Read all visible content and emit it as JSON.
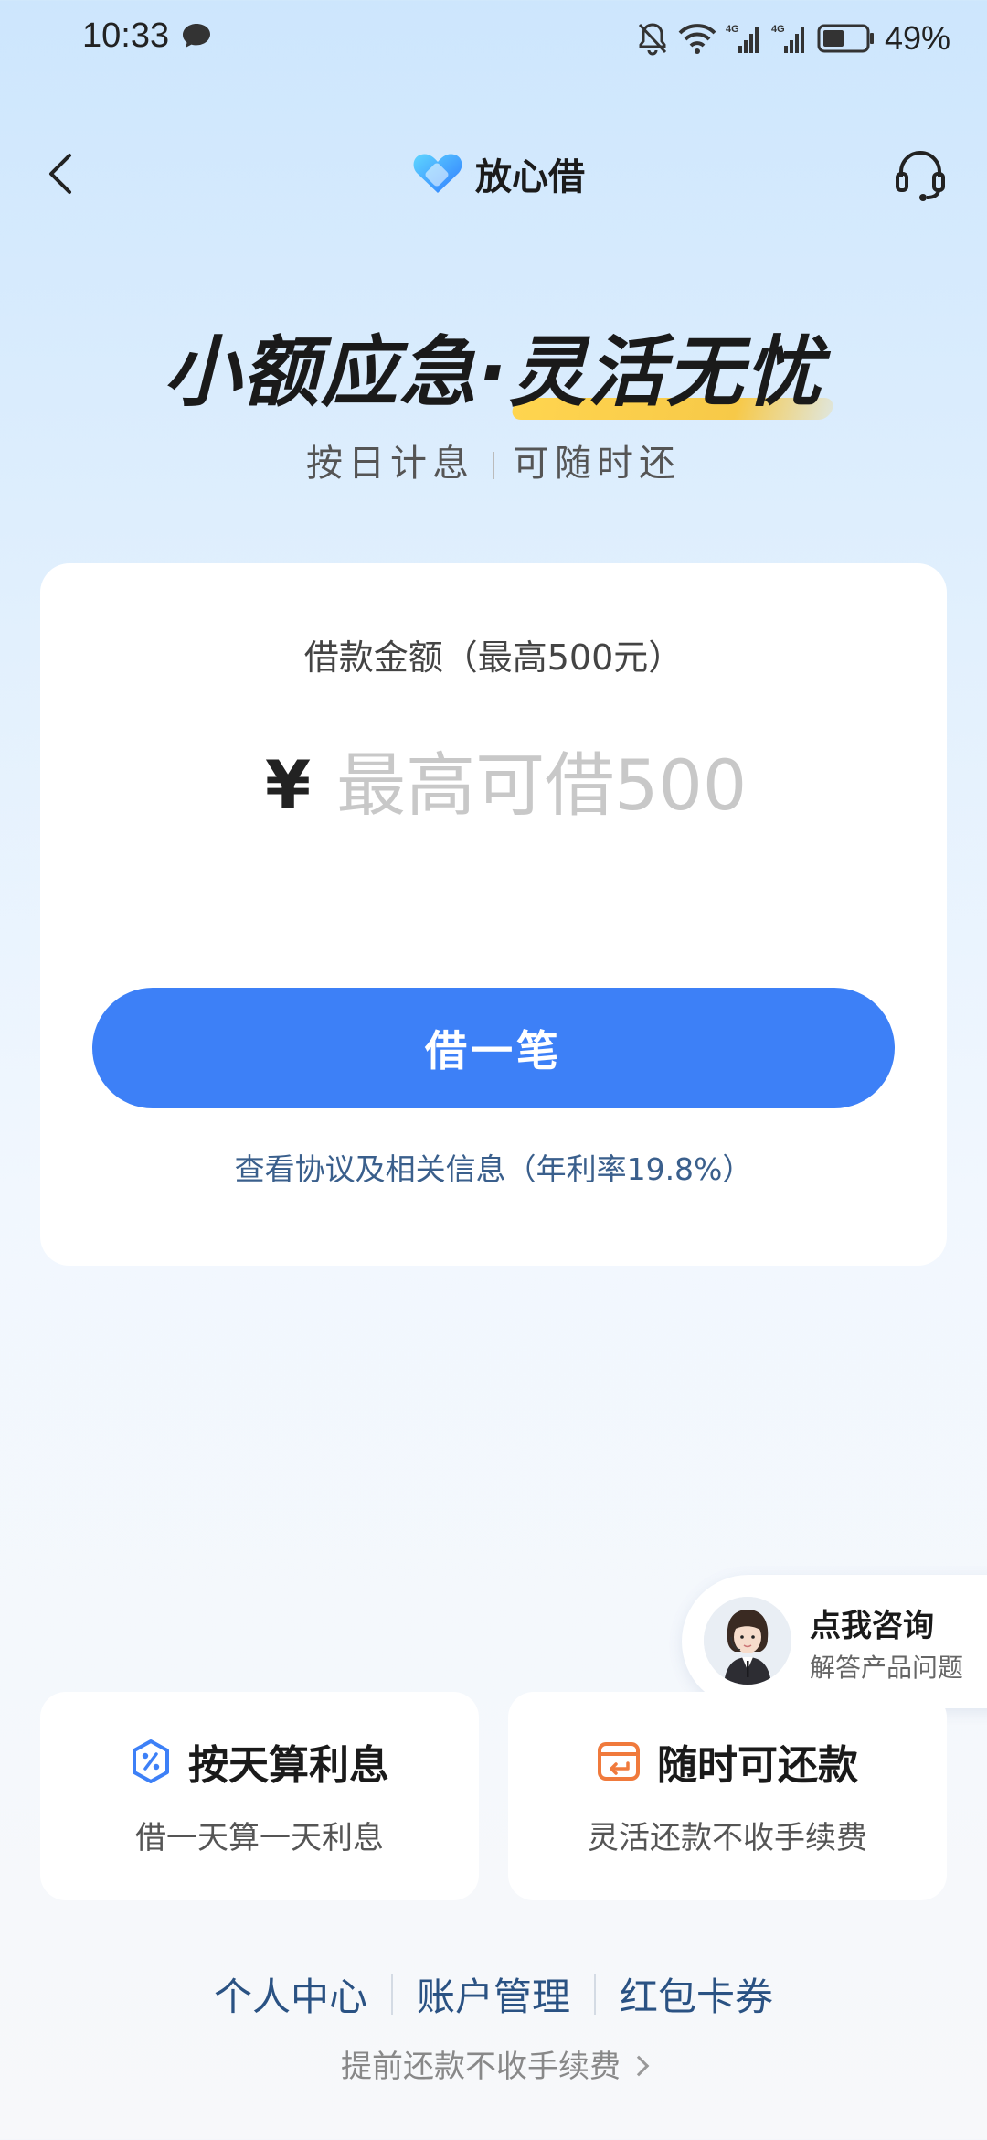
{
  "status_bar": {
    "time": "10:33",
    "battery_percent": "49%",
    "battery_level": 0.49,
    "icons": [
      "message-icon",
      "bell-muted-icon",
      "wifi-icon",
      "signal-4g-icon",
      "signal-4g-icon",
      "battery-icon"
    ]
  },
  "nav": {
    "brand_name": "放心借",
    "back_icon": "chevron-left-icon",
    "support_icon": "headset-icon"
  },
  "hero": {
    "title_part1": "小额应急·",
    "title_part2": "灵活无忧",
    "subtitle_left": "按日计息",
    "subtitle_right": "可随时还"
  },
  "loan_card": {
    "amount_label": "借款金额（最高500元）",
    "currency_symbol": "¥",
    "amount_placeholder": "最高可借500",
    "amount_value": "",
    "borrow_button": "借一笔",
    "agreement_link": "查看协议及相关信息（年利率19.8%）"
  },
  "consult": {
    "title": "点我咨询",
    "subtitle": "解答产品问题"
  },
  "features": [
    {
      "icon": "percent-badge-icon",
      "title": "按天算利息",
      "desc": "借一天算一天利息"
    },
    {
      "icon": "card-return-icon",
      "title": "随时可还款",
      "desc": "灵活还款不收手续费"
    }
  ],
  "footer": {
    "links": [
      "个人中心",
      "账户管理",
      "红包卡券"
    ],
    "note": "提前还款不收手续费"
  },
  "colors": {
    "primary": "#3d80f7",
    "link": "#2a5283",
    "accent_orange": "#f07a3c",
    "highlight_yellow": "#f7c948"
  }
}
